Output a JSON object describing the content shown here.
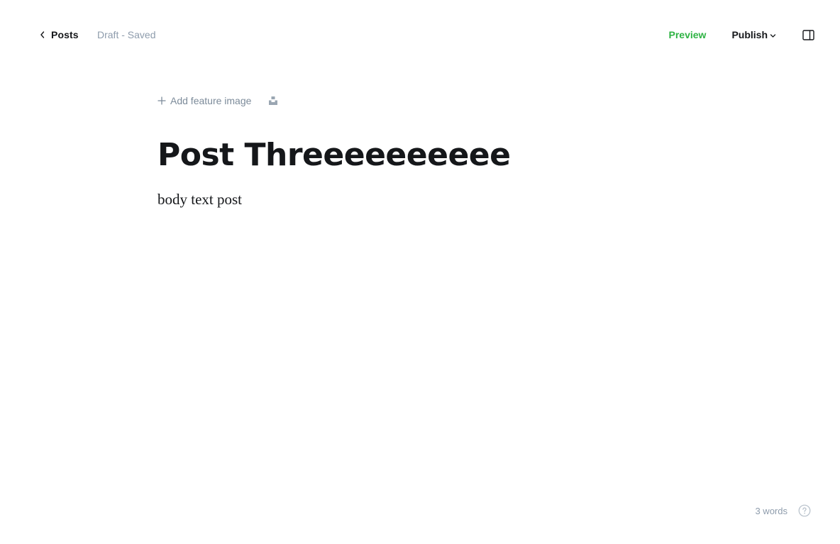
{
  "header": {
    "back_label": "Posts",
    "status": "Draft - Saved",
    "preview_label": "Preview",
    "publish_label": "Publish"
  },
  "icons": {
    "back": "chevron-left-icon",
    "publish_menu": "chevron-down-icon",
    "sidebar": "sidebar-toggle-icon",
    "add": "plus-icon",
    "unsplash": "unsplash-icon",
    "help": "help-circle-icon"
  },
  "editor": {
    "add_feature_label": "Add feature image",
    "title": "Post Threeeeeeeeee",
    "body": "body text post"
  },
  "footer": {
    "word_count": "3 words"
  },
  "colors": {
    "accent_green": "#2fb344",
    "muted_text": "#8e9cac",
    "text": "#15171a"
  }
}
